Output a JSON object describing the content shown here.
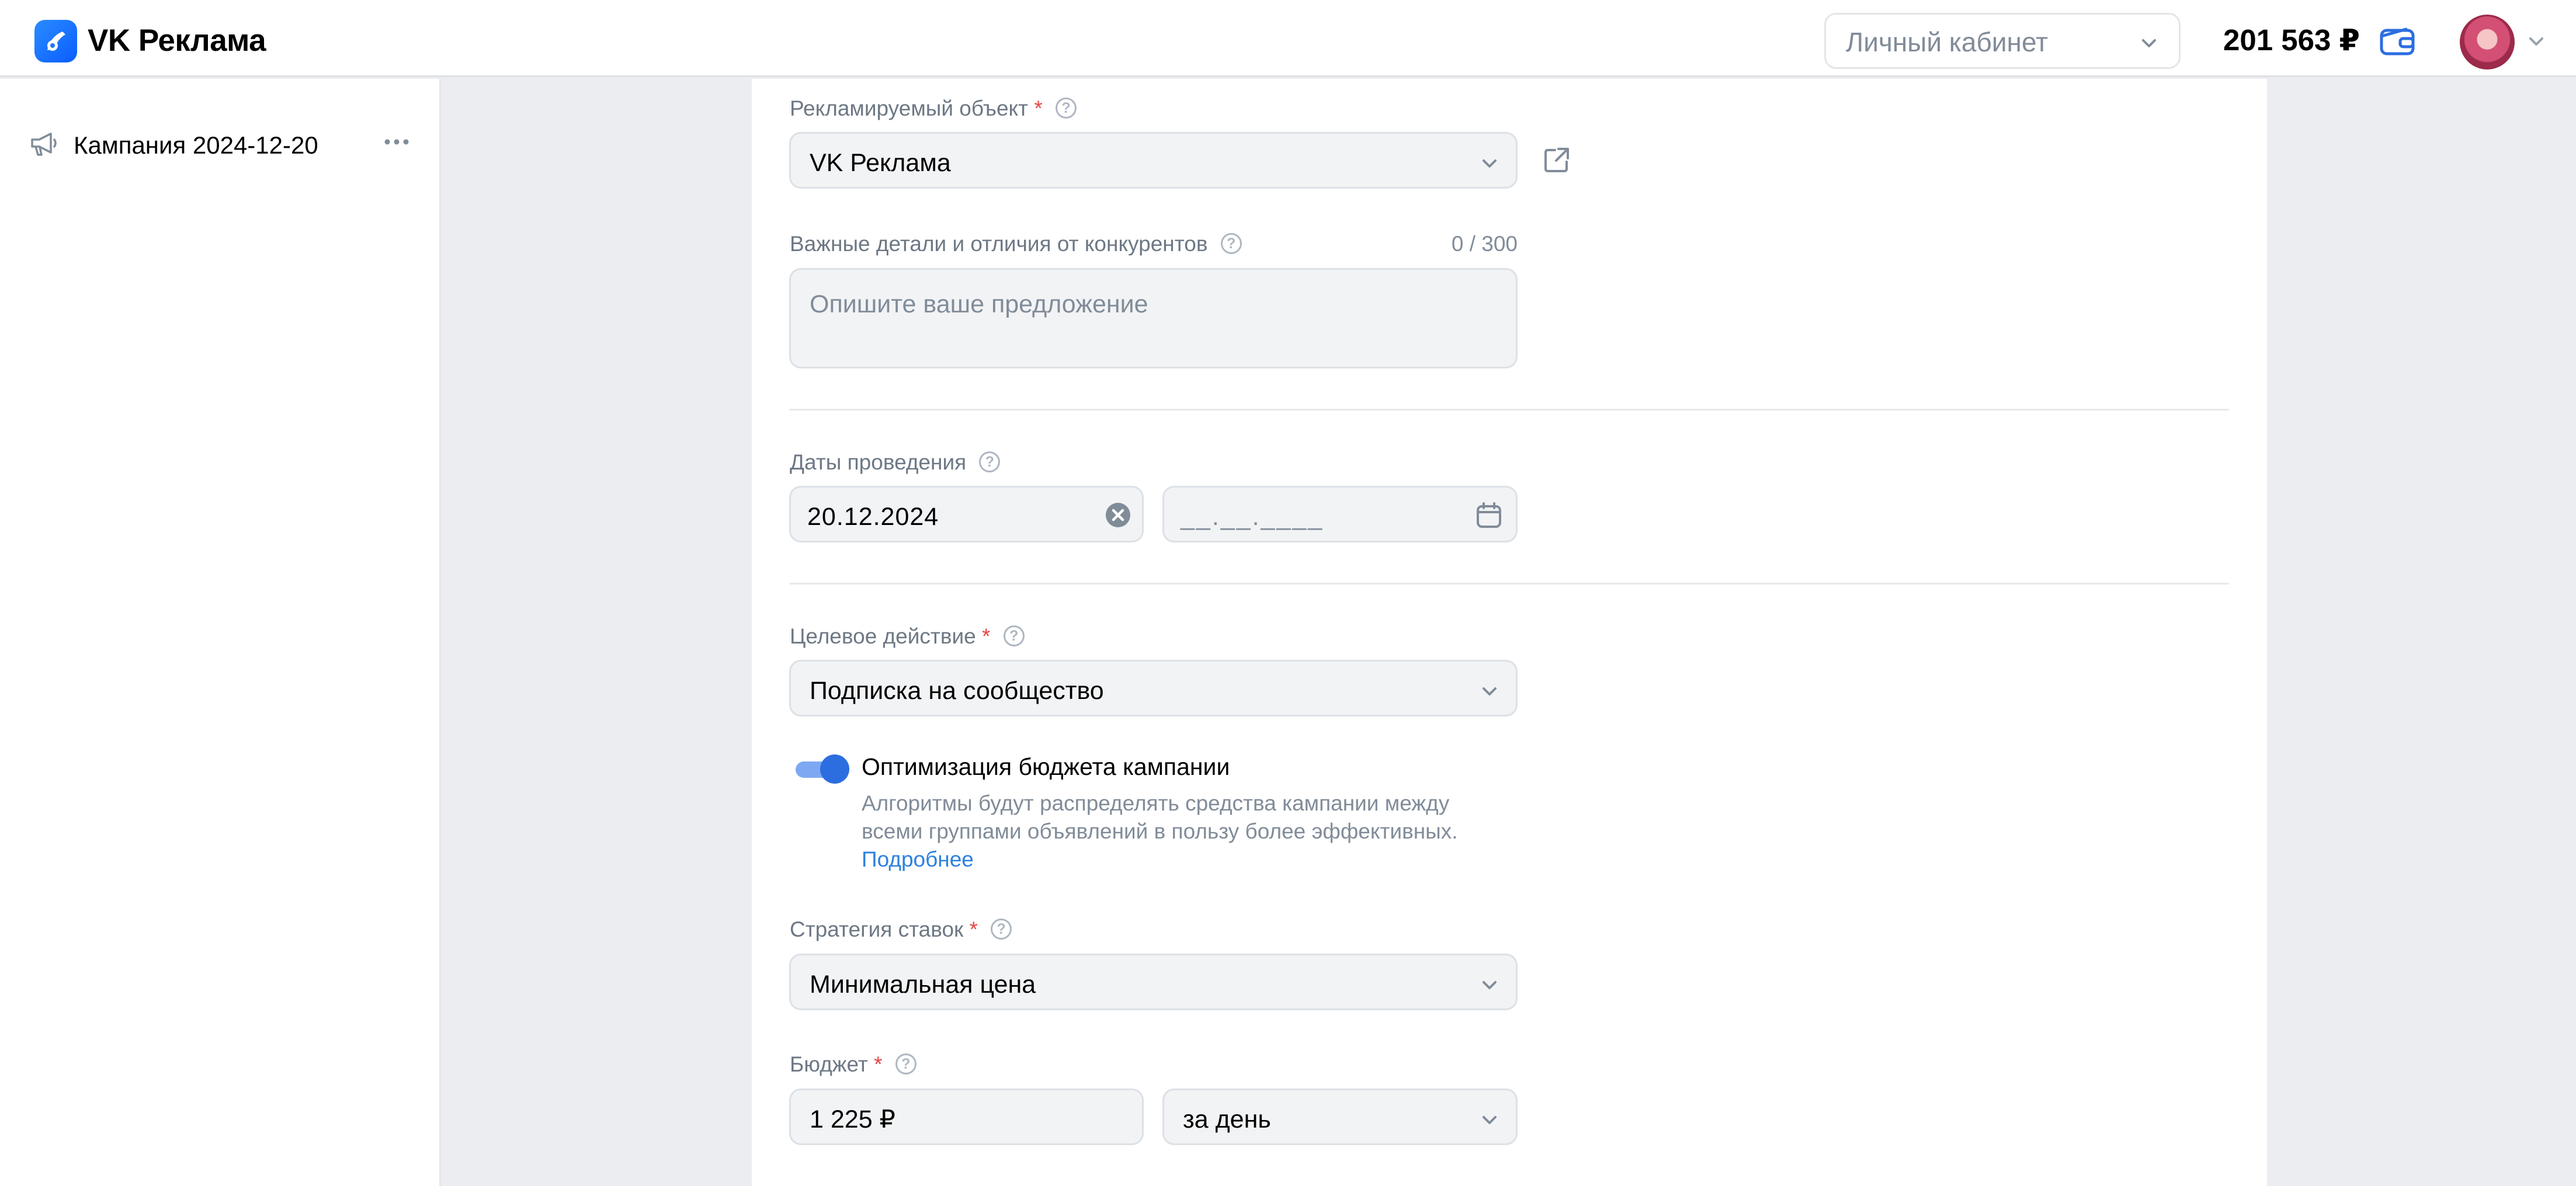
{
  "header": {
    "brand": "VK Реклама",
    "cabinet_label": "Личный кабинет",
    "balance": "201 563 ₽"
  },
  "sidebar": {
    "campaign_name": "Кампания 2024-12-20"
  },
  "form": {
    "object": {
      "label": "Рекламируемый объект",
      "required_mark": "*",
      "value": "VK Реклама"
    },
    "details": {
      "label": "Важные детали и отличия от конкурентов",
      "counter": "0 / 300",
      "placeholder": "Опишите ваше предложение"
    },
    "dates": {
      "label": "Даты проведения",
      "start": "20.12.2024",
      "end_placeholder": "__.__.____"
    },
    "target_action": {
      "label": "Целевое действие",
      "required_mark": "*",
      "value": "Подписка на сообщество"
    },
    "budget_optimization": {
      "enabled": true,
      "title": "Оптимизация бюджета кампании",
      "description": "Алгоритмы будут распределять средства кампании между всеми группами объявлений в пользу более эффективных.",
      "link": "Подробнее"
    },
    "bid_strategy": {
      "label": "Стратегия ставок",
      "required_mark": "*",
      "value": "Минимальная цена"
    },
    "budget": {
      "label": "Бюджет",
      "required_mark": "*",
      "amount": "1 225 ₽",
      "period": "за день"
    }
  },
  "colors": {
    "accent": "#2c6ee0",
    "link": "#2d81e0",
    "required": "#e64646"
  }
}
